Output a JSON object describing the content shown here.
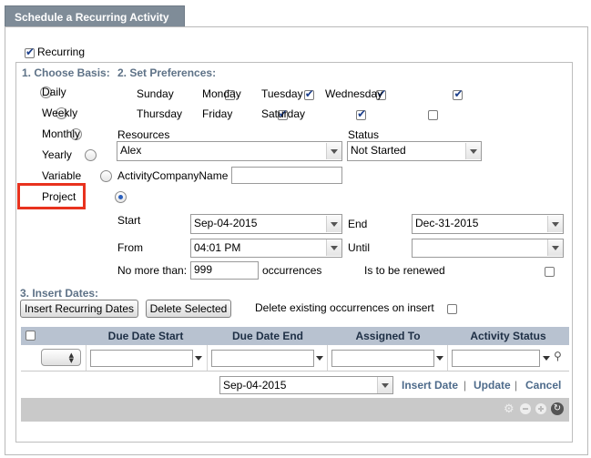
{
  "tab_title": "Schedule a Recurring Activity",
  "recurring": {
    "label": "Recurring",
    "checked": true
  },
  "basis": {
    "header": "1. Choose Basis:",
    "options": [
      {
        "label": "Daily",
        "selected": false
      },
      {
        "label": "Weekly",
        "selected": false
      },
      {
        "label": "Monthly",
        "selected": false
      },
      {
        "label": "Yearly",
        "selected": false
      },
      {
        "label": "Variable",
        "selected": false
      },
      {
        "label": "Project",
        "selected": true
      }
    ]
  },
  "preferences": {
    "header": "2. Set Preferences:",
    "days": [
      {
        "label": "Sunday",
        "checked": false
      },
      {
        "label": "Monday",
        "checked": true
      },
      {
        "label": "Tuesday",
        "checked": true
      },
      {
        "label": "Wednesday",
        "checked": true
      },
      {
        "label": "Thursday",
        "checked": true
      },
      {
        "label": "Friday",
        "checked": true
      },
      {
        "label": "Saturday",
        "checked": false
      }
    ],
    "resources_label": "Resources",
    "resources_value": "Alex",
    "status_label": "Status",
    "status_value": "Not Started",
    "company_label": "ActivityCompanyName",
    "company_value": "",
    "start_label": "Start",
    "start_value": "Sep-04-2015",
    "end_label": "End",
    "end_value": "Dec-31-2015",
    "from_label": "From",
    "from_value": "04:01 PM",
    "until_label": "Until",
    "until_value": "",
    "nomore_label": "No more than:",
    "nomore_value": "999",
    "occurrences_label": "occurrences",
    "renewed_label": "Is to be renewed",
    "renewed_checked": false
  },
  "insert": {
    "header": "3. Insert Dates:",
    "insert_button": "Insert Recurring Dates",
    "delete_button": "Delete Selected",
    "delete_existing_label": "Delete existing occurrences on insert",
    "delete_existing_checked": false
  },
  "grid": {
    "columns": [
      "Due Date Start",
      "Due Date End",
      "Assigned To",
      "Activity Status"
    ],
    "date_value": "Sep-04-2015",
    "actions": [
      "Insert Date",
      "Update",
      "Cancel"
    ],
    "separator": "|"
  },
  "colors": {
    "tab_bg": "#7f8c98",
    "header_text": "#5e7287",
    "highlight": "#e8321e",
    "grid_header": "#b8c2d0",
    "link": "#4e6b8b"
  },
  "icons": [
    "check-icon",
    "radio-icon",
    "dropdown-arrow-icon",
    "spinner-icon",
    "filter-icon",
    "gear-icon",
    "remove-icon",
    "add-icon",
    "refresh-icon"
  ]
}
